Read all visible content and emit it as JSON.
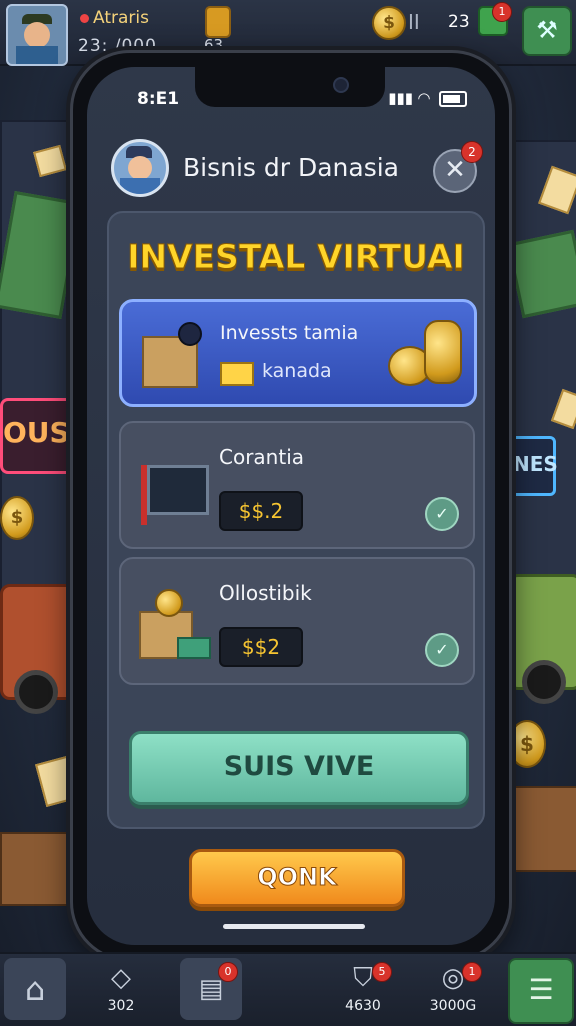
{
  "hud": {
    "player_name": "Atraris",
    "stat_primary": "23: /000",
    "stat_secondary": "63",
    "coins": "23",
    "coin_bars": "II",
    "gem_badge": "1",
    "tool_icon": "hammer-icon"
  },
  "phone": {
    "status_time": "8:E1",
    "header_title": "Bisnis dr Danasia",
    "close_badge": "2",
    "close_glyph": "✕",
    "banner": "INVESTAL VIRTUAI",
    "cards": [
      {
        "title": "Invessts tamia",
        "subtitle": "kanada",
        "featured": true
      },
      {
        "title": "Corantia",
        "price": "$$.2",
        "check": "✓"
      },
      {
        "title": "Ollostibik",
        "price": "$$2",
        "check": "✓"
      }
    ],
    "primary_button": "SUIS VIVE",
    "secondary_button": "QONK"
  },
  "nav": {
    "items": [
      {
        "icon": "home-icon",
        "label": ""
      },
      {
        "icon": "map-icon",
        "label": "302"
      },
      {
        "icon": "calendar-icon",
        "label": "",
        "badge": "0"
      },
      {
        "icon": "shield-icon",
        "label": "4630",
        "badge": "5"
      },
      {
        "icon": "compass-icon",
        "label": "3000G",
        "badge": "1"
      },
      {
        "icon": "menu-icon",
        "label": ""
      }
    ]
  },
  "background_signs": {
    "left_neon": "OUSB",
    "right_neon": "NES"
  },
  "colors": {
    "banner_yellow": "#ffd52a",
    "featured_blue": "#3a5ac4",
    "button_green": "#7ccfb4",
    "button_orange": "#f6a531",
    "price_gold": "#f6c431"
  }
}
